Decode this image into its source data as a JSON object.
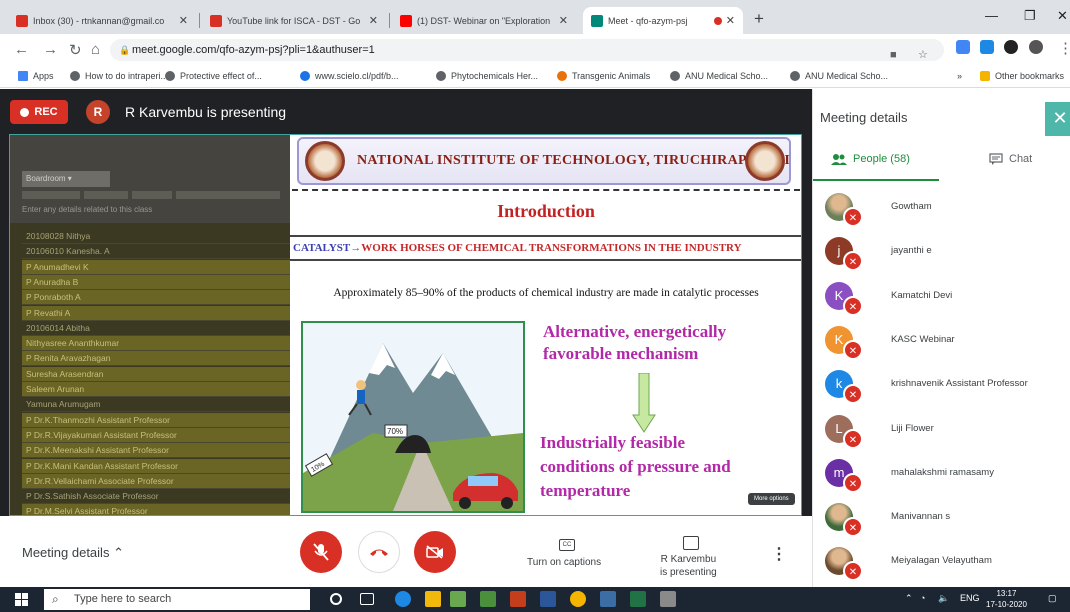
{
  "browser": {
    "tabs": [
      {
        "title": "Inbox (30) - rtnkannan@gmail.co",
        "icon": "gmail-icon",
        "color": "#d93025",
        "active": false
      },
      {
        "title": "YouTube link for ISCA - DST - Go",
        "icon": "gmail-icon",
        "color": "#d93025",
        "active": false
      },
      {
        "title": "(1) DST- Webinar on \"Exploration",
        "icon": "youtube-icon",
        "color": "#ff0000",
        "active": false
      },
      {
        "title": "Meet - qfo-azym-psj",
        "icon": "meet-icon",
        "color": "#00897b",
        "active": true
      }
    ],
    "url": "meet.google.com/qfo-azym-psj?pli=1&authuser=1",
    "bookmarks": [
      {
        "label": "Apps",
        "color": "#4285f4"
      },
      {
        "label": "How to do intraperi...",
        "color": "#5f6368"
      },
      {
        "label": "Protective effect of...",
        "color": "#5f6368"
      },
      {
        "label": "www.scielo.cl/pdf/b...",
        "color": "#1a73e8"
      },
      {
        "label": "Phytochemicals Her...",
        "color": "#5f6368"
      },
      {
        "label": "Transgenic Animals",
        "color": "#e8710a"
      },
      {
        "label": "ANU Medical Scho...",
        "color": "#5f6368"
      },
      {
        "label": "ANU Medical Scho...",
        "color": "#5f6368"
      }
    ],
    "other_bookmarks": "Other bookmarks",
    "more_bookmarks": "»"
  },
  "meet": {
    "rec_label": "REC",
    "presenter_initial": "R",
    "presenting_title": "R Karvembu is presenting",
    "left_panel": {
      "dropdown": "Boardroom",
      "subtext": "Enter any details related to this class",
      "rows": [
        {
          "text": "20108028 Nithya",
          "hl": false
        },
        {
          "text": "20106010 Kanesha. A",
          "hl": false
        },
        {
          "text": "P Anumadhevi K",
          "hl": true
        },
        {
          "text": "P Anuradha B",
          "hl": true
        },
        {
          "text": "P Ponraboth A",
          "hl": true
        },
        {
          "text": "P Revathi A",
          "hl": true
        },
        {
          "text": "20106014 Abitha",
          "hl": false
        },
        {
          "text": "Nithyasree Ananthkumar",
          "hl": true
        },
        {
          "text": "P Renita Aravazhagan",
          "hl": true
        },
        {
          "text": "Suresha Arasendran",
          "hl": true
        },
        {
          "text": "Saleem Arunan",
          "hl": true
        },
        {
          "text": "Yamuna Arumugam",
          "hl": false
        },
        {
          "text": "P Dr.K.Thanmozhi Assistant Professor",
          "hl": true
        },
        {
          "text": "P Dr.R.Vijayakumari Assistant Professor",
          "hl": true
        },
        {
          "text": "P Dr.K.Meenakshi Assistant Professor",
          "hl": true
        },
        {
          "text": "P Dr.K.Mani Kandan Assistant Professor",
          "hl": true
        },
        {
          "text": "P Dr.R.Vellaichami Associate Professor",
          "hl": true
        },
        {
          "text": "P Dr.S.Sathish Associate Professor",
          "hl": false
        },
        {
          "text": "P Dr.M.Selvi Assistant Professor",
          "hl": true
        }
      ]
    },
    "slide": {
      "institute": "NATIONAL INSTITUTE OF TECHNOLOGY, TIRUCHIRAPPALLI",
      "title": "Introduction",
      "catalyst_a": "CATALYST",
      "catalyst_b": "→WORK HORSES OF CHEMICAL TRANSFORMATIONS IN THE  INDUSTRY",
      "approx": "Approximately 85–90% of the products of chemical industry are made in catalytic processes",
      "alt_line1": "Alternative, energetically",
      "alt_line2": "favorable mechanism",
      "ind_line1": "Industrially feasible",
      "ind_line2": "conditions of pressure and",
      "ind_line3": "temperature",
      "sign_mountain": "70%",
      "sign_road": "10%"
    },
    "controls": {
      "meeting_details": "Meeting details",
      "captions_label": "Turn on captions",
      "captions_icon": "CC",
      "presenting_line1": "R Karvembu",
      "presenting_line2": "is presenting",
      "more_options_tooltip": "More options"
    }
  },
  "sidebar": {
    "title": "Meeting details",
    "people_tab": "People (58)",
    "chat_tab": "Chat",
    "participants": [
      {
        "name": "Gowtham",
        "initial": "",
        "color": "#6b7f5a",
        "photo": true
      },
      {
        "name": "jayanthi e",
        "initial": "j",
        "color": "#8d3a26",
        "photo": false
      },
      {
        "name": "Kamatchi Devi",
        "initial": "K",
        "color": "#8a4fc1",
        "photo": false
      },
      {
        "name": "KASC Webinar",
        "initial": "K",
        "color": "#f09331",
        "photo": false
      },
      {
        "name": "krishnavenik Assistant Professor",
        "initial": "k",
        "color": "#1e88e5",
        "photo": false
      },
      {
        "name": "Liji Flower",
        "initial": "L",
        "color": "#9e6e5c",
        "photo": false
      },
      {
        "name": "mahalakshmi ramasamy",
        "initial": "m",
        "color": "#6a2ea5",
        "photo": false
      },
      {
        "name": "Manivannan s",
        "initial": "",
        "color": "#3d6a3a",
        "photo": true
      },
      {
        "name": "Meiyalagan Velayutham",
        "initial": "",
        "color": "#6b4a2e",
        "photo": true
      }
    ]
  },
  "taskbar": {
    "search_placeholder": "Type here to search",
    "lang": "ENG",
    "time": "13:17",
    "date": "17-10-2020"
  }
}
